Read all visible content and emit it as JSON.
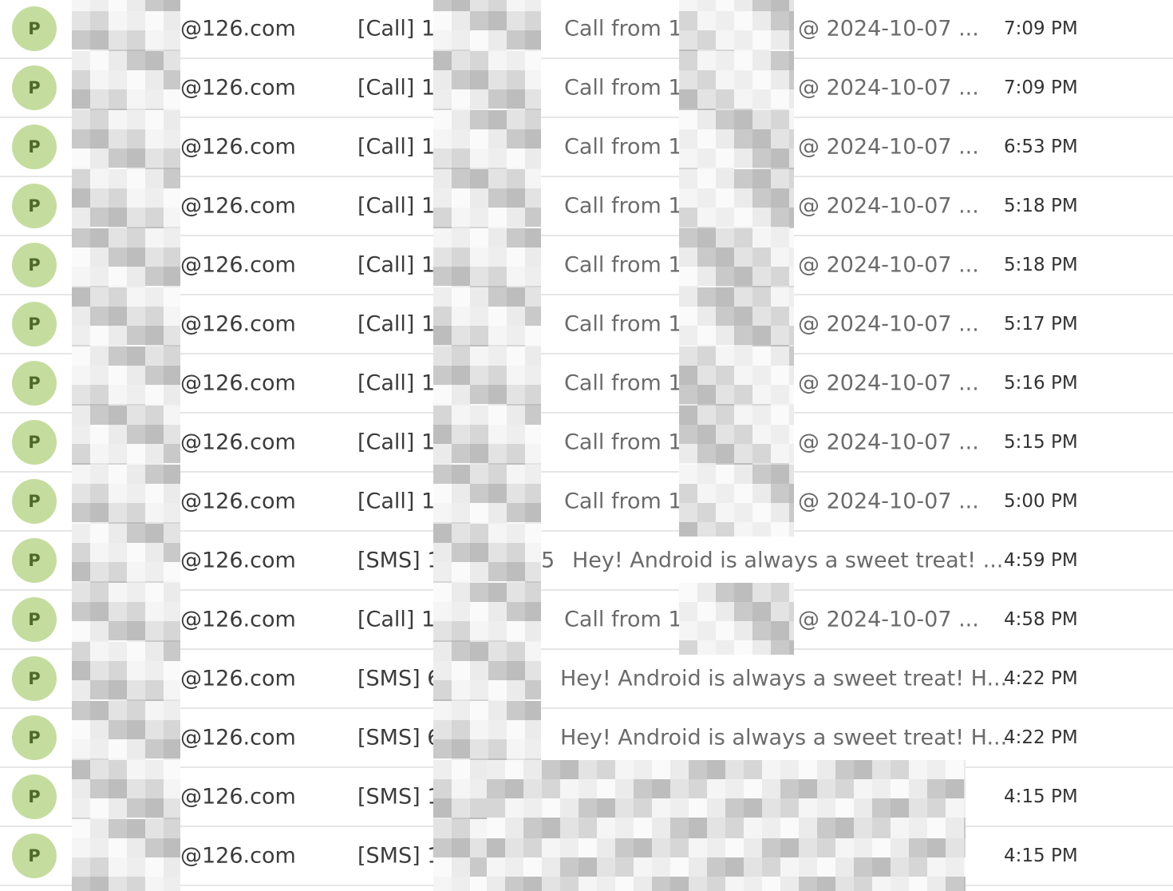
{
  "colors": {
    "avatar_bg": "#c5dc9f",
    "avatar_text": "#4d6a2b",
    "divider": "#e6e6e6",
    "preview_text": "#6b6b6b"
  },
  "messages": [
    {
      "avatar": "P",
      "sender_domain": "@126.com",
      "subject_prefix": "[Call] 18",
      "preview": "Call from 18",
      "preview_suffix": "@ 2024-10-07 ...",
      "time": "7:09 PM",
      "kind": "call"
    },
    {
      "avatar": "P",
      "sender_domain": "@126.com",
      "subject_prefix": "[Call] 18",
      "preview": "Call from 18",
      "preview_suffix": "@ 2024-10-07 ...",
      "time": "7:09 PM",
      "kind": "call"
    },
    {
      "avatar": "P",
      "sender_domain": "@126.com",
      "subject_prefix": "[Call] 18",
      "preview": "Call from 18",
      "preview_suffix": "@ 2024-10-07 ...",
      "time": "6:53 PM",
      "kind": "call"
    },
    {
      "avatar": "P",
      "sender_domain": "@126.com",
      "subject_prefix": "[Call] 18",
      "preview": "Call from 18",
      "preview_suffix": "@ 2024-10-07 ...",
      "time": "5:18 PM",
      "kind": "call"
    },
    {
      "avatar": "P",
      "sender_domain": "@126.com",
      "subject_prefix": "[Call] 18",
      "preview": "Call from 18",
      "preview_suffix": "@ 2024-10-07 ...",
      "time": "5:18 PM",
      "kind": "call"
    },
    {
      "avatar": "P",
      "sender_domain": "@126.com",
      "subject_prefix": "[Call] 18",
      "preview": "Call from 18",
      "preview_suffix": "@ 2024-10-07 ...",
      "time": "5:17 PM",
      "kind": "call"
    },
    {
      "avatar": "P",
      "sender_domain": "@126.com",
      "subject_prefix": "[Call] 18",
      "preview": "Call from 18",
      "preview_suffix": "@ 2024-10-07 ...",
      "time": "5:16 PM",
      "kind": "call"
    },
    {
      "avatar": "P",
      "sender_domain": "@126.com",
      "subject_prefix": "[Call] 18",
      "preview": "Call from 18",
      "preview_suffix": "@ 2024-10-07 ...",
      "time": "5:15 PM",
      "kind": "call"
    },
    {
      "avatar": "P",
      "sender_domain": "@126.com",
      "subject_prefix": "[Call] 18",
      "preview": "Call from 18",
      "preview_suffix": "@ 2024-10-07 ...",
      "time": "5:00 PM",
      "kind": "call"
    },
    {
      "avatar": "P",
      "sender_domain": "@126.com",
      "subject_prefix": "[SMS] 1",
      "subject_tail": "5",
      "preview": "Hey! Android is always a sweet treat! ...",
      "preview_suffix": "",
      "time": "4:59 PM",
      "kind": "sms1"
    },
    {
      "avatar": "P",
      "sender_domain": "@126.com",
      "subject_prefix": "[Call] 18",
      "preview": "Call from 18",
      "preview_suffix": "@ 2024-10-07 ...",
      "time": "4:58 PM",
      "kind": "call"
    },
    {
      "avatar": "P",
      "sender_domain": "@126.com",
      "subject_prefix": "[SMS] 6",
      "preview": "Hey! Android is always a sweet treat! H...",
      "preview_suffix": "",
      "time": "4:22 PM",
      "kind": "sms2"
    },
    {
      "avatar": "P",
      "sender_domain": "@126.com",
      "subject_prefix": "[SMS] 6",
      "preview": "Hey! Android is always a sweet treat! H...",
      "preview_suffix": "",
      "time": "4:22 PM",
      "kind": "sms2"
    },
    {
      "avatar": "P",
      "sender_domain": "@126.com",
      "subject_prefix": "[SMS] 1",
      "preview": "",
      "preview_suffix": "",
      "time": "4:15 PM",
      "kind": "redacted"
    },
    {
      "avatar": "P",
      "sender_domain": "@126.com",
      "subject_prefix": "[SMS] 1",
      "preview": "",
      "preview_suffix": "",
      "time": "4:15 PM",
      "kind": "redacted"
    }
  ]
}
